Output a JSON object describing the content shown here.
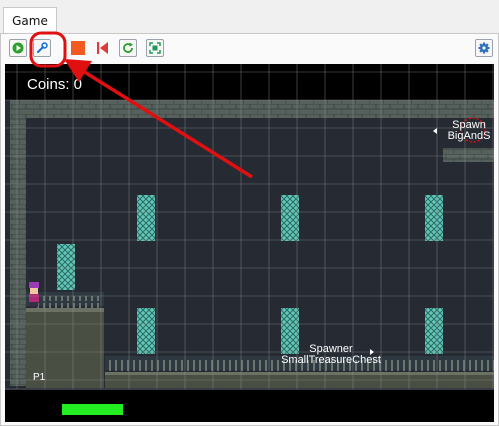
{
  "tabs": [
    {
      "label": "Game"
    }
  ],
  "toolbar": {
    "buttons": [
      {
        "name": "play",
        "icon": "play-icon"
      },
      {
        "name": "wrench",
        "icon": "wrench-icon"
      },
      {
        "name": "stop",
        "icon": "stop-icon"
      },
      {
        "name": "restart",
        "icon": "step-back-icon"
      },
      {
        "name": "refresh",
        "icon": "refresh-icon"
      },
      {
        "name": "fit",
        "icon": "fit-view-icon"
      },
      {
        "name": "settings",
        "icon": "gear-icon"
      }
    ]
  },
  "game": {
    "coins_text": "Coins: 0",
    "spawner_top": {
      "line1": "Spawn",
      "line2": "BigAndS"
    },
    "spawner_bottom": {
      "line1": "Spawner",
      "line2": "SmallTreasureChest"
    },
    "player_label": "P1",
    "health_fraction": 1.0
  },
  "colors": {
    "accent_red": "#e01010",
    "health_green": "#22ee22",
    "window_teal": "#5fc8b8",
    "wall_stone": "#56615d",
    "play_green": "#2ca02c",
    "stop_orange": "#f25a22"
  }
}
